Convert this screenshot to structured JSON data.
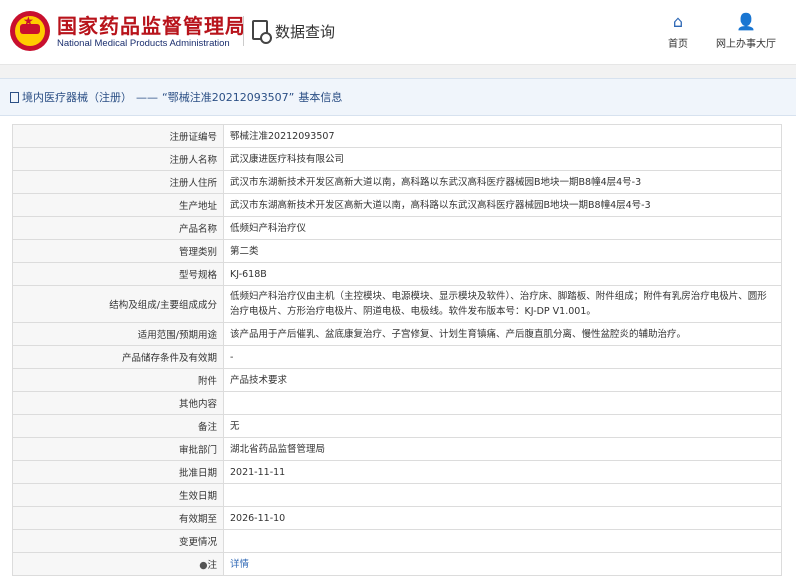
{
  "header": {
    "site_title": "国家药品监督管理局",
    "site_subtitle": "National Medical Products Administration",
    "query_title": "数据查询",
    "nav": [
      {
        "label": "首页",
        "icon": "home-icon"
      },
      {
        "label": "网上办事大厅",
        "icon": "user-icon"
      }
    ]
  },
  "breadcrumb": {
    "category": "境内医疗器械（注册）",
    "separator": "——",
    "record": "“鄂械注准20212093507”",
    "suffix": "基本信息"
  },
  "rows": [
    {
      "label": "注册证编号",
      "value": "鄂械注准20212093507"
    },
    {
      "label": "注册人名称",
      "value": "武汉康进医疗科技有限公司"
    },
    {
      "label": "注册人住所",
      "value": "武汉市东湖新技术开发区高新大道以南，高科路以东武汉高科医疗器械园B地块一期B8幢4层4号-3"
    },
    {
      "label": "生产地址",
      "value": "武汉市东湖高新技术开发区高新大道以南，高科路以东武汉高科医疗器械园B地块一期B8幢4层4号-3"
    },
    {
      "label": "产品名称",
      "value": "低频妇产科治疗仪"
    },
    {
      "label": "管理类别",
      "value": "第二类"
    },
    {
      "label": "型号规格",
      "value": "KJ-618B"
    },
    {
      "label": "结构及组成/主要组成成分",
      "value": "低频妇产科治疗仪由主机（主控模块、电源模块、显示模块及软件）、治疗床、脚踏板、附件组成；附件有乳房治疗电极片、圆形治疗电极片、方形治疗电极片、阴道电极、电极线。软件发布版本号：KJ-DP V1.001。"
    },
    {
      "label": "适用范围/预期用途",
      "value": "该产品用于产后催乳、盆底康复治疗、子宫修复、计划生育镇痛、产后腹直肌分离、慢性盆腔炎的辅助治疗。"
    },
    {
      "label": "产品储存条件及有效期",
      "value": "-"
    },
    {
      "label": "附件",
      "value": "产品技术要求"
    },
    {
      "label": "其他内容",
      "value": ""
    },
    {
      "label": "备注",
      "value": "无"
    },
    {
      "label": "审批部门",
      "value": "湖北省药品监督管理局"
    },
    {
      "label": "批准日期",
      "value": "2021-11-11"
    },
    {
      "label": "生效日期",
      "value": ""
    },
    {
      "label": "有效期至",
      "value": "2026-11-10"
    },
    {
      "label": "变更情况",
      "value": ""
    }
  ],
  "note_row": {
    "label_icon": "pin-icon",
    "label": "注",
    "link_text": "详情"
  }
}
